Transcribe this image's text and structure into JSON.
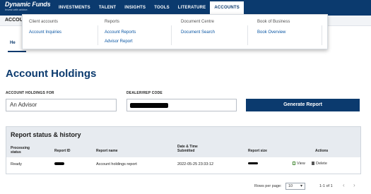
{
  "brand": {
    "name": "Dynamic Funds",
    "tagline": "Invest with advice."
  },
  "nav": {
    "items": [
      "INVESTMENTS",
      "TALENT",
      "INSIGHTS",
      "TOOLS",
      "LITERATURE",
      "ACCOUNTS"
    ],
    "active": "ACCOUNTS"
  },
  "subnav": {
    "label": "ACCOU",
    "tab_label": "He"
  },
  "mega_menu": {
    "columns": [
      {
        "heading": "Client accounts",
        "links": [
          "Account Inquiries"
        ]
      },
      {
        "heading": "Reports",
        "links": [
          "Account Reports",
          "Advisor Report"
        ]
      },
      {
        "heading": "Document Centre",
        "links": [
          "Document Search"
        ]
      },
      {
        "heading": "Book of Business",
        "links": [
          "Book Overview"
        ]
      }
    ]
  },
  "page": {
    "title": "Account Holdings"
  },
  "form": {
    "for_label": "ACCOUNT HOLDINGS FOR",
    "for_value": "An Advisor",
    "code_label": "DEALER/REP CODE",
    "generate_label": "Generate Report"
  },
  "report": {
    "title": "Report status & history",
    "headers": {
      "status": "Processing status",
      "id": "Report ID",
      "name": "Report name",
      "date": "Date & Time Submitted",
      "size": "Report size",
      "actions": "Actions"
    },
    "rows": [
      {
        "status": "Ready",
        "name": "Account holdings report",
        "date": "2022-05-25 23:33:12",
        "view": "View",
        "delete": "Delete"
      }
    ]
  },
  "pagination": {
    "rows_per_page_label": "Rows per page:",
    "rows_per_page": "10",
    "range": "1-1 of 1",
    "prev": "‹",
    "next": "›"
  },
  "colors": {
    "nav_bg": "#0b3a6e",
    "accent": "#0b3a6e",
    "link": "#0b57a4"
  }
}
